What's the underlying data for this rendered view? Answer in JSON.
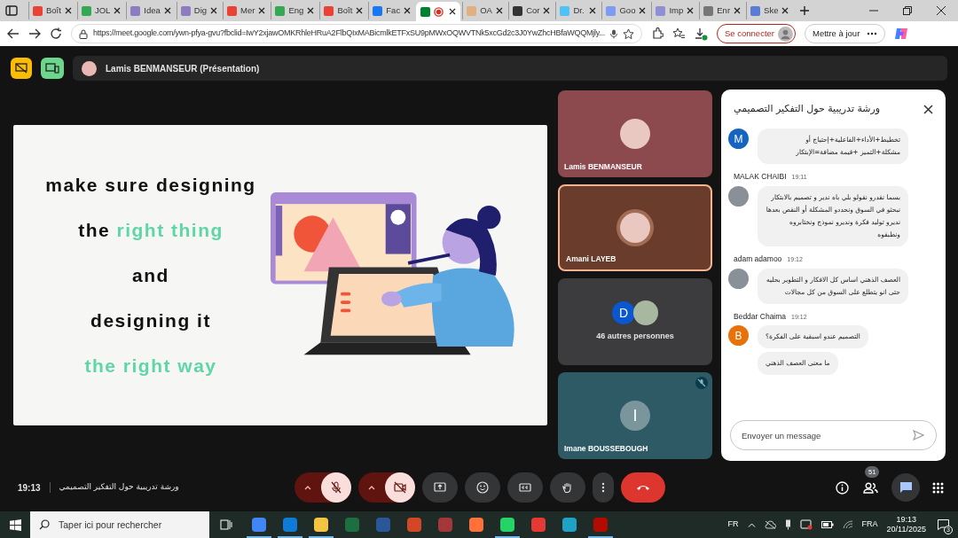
{
  "browser": {
    "tabs": [
      {
        "label": "Boît",
        "selected": false,
        "color": "#ea4335"
      },
      {
        "label": "JOL",
        "selected": false,
        "color": "#34a853"
      },
      {
        "label": "Idea",
        "selected": false,
        "color": "#8e7cc3"
      },
      {
        "label": "Dig",
        "selected": false,
        "color": "#8e7cc3"
      },
      {
        "label": "Mer",
        "selected": false,
        "color": "#ea4335"
      },
      {
        "label": "Eng",
        "selected": false,
        "color": "#34a853"
      },
      {
        "label": "Boît",
        "selected": false,
        "color": "#ea4335"
      },
      {
        "label": "Fac",
        "selected": false,
        "color": "#1877f2"
      },
      {
        "selected": true,
        "color": "#00832d"
      },
      {
        "label": "OA",
        "selected": false,
        "color": "#e0b080"
      },
      {
        "label": "Cor",
        "selected": false,
        "color": "#333333"
      },
      {
        "label": "Dr.",
        "selected": false,
        "color": "#4fc3f7"
      },
      {
        "label": "Goo",
        "selected": false,
        "color": "#7b9cf0"
      },
      {
        "label": "Imp",
        "selected": false,
        "color": "#8f8fd6"
      },
      {
        "label": "Enr",
        "selected": false,
        "color": "#777777"
      },
      {
        "label": "Ske",
        "selected": false,
        "color": "#5a7bd6"
      }
    ],
    "url": "https://meet.google.com/ywn-pfya-gvu?fbclid=IwY2xjawOMKRhleHRuA2FlbQIxMABicmlkETFxSU9pMWxOQWVTNk5xcGd2c3J0YwZhcHBfaWQQMjly...",
    "sign_in": "Se connecter",
    "update": "Mettre à jour"
  },
  "meet": {
    "presenter": "Lamis BENMANSEUR (Présentation)",
    "slide": {
      "lines": [
        [
          {
            "text": "make sure designing",
            "accent": false
          }
        ],
        [
          {
            "text": "the ",
            "accent": false
          },
          {
            "text": "right thing",
            "accent": true
          }
        ],
        [
          {
            "text": "and",
            "accent": false
          }
        ],
        [
          {
            "text": "designing it",
            "accent": false
          }
        ],
        [
          {
            "text": "the right way",
            "accent": true
          }
        ]
      ]
    },
    "tiles": [
      {
        "kind": "photo",
        "name": "Lamis BENMANSEUR",
        "speaking": false,
        "muted": false
      },
      {
        "kind": "photo",
        "name": "Amani LAYEB",
        "speaking": true,
        "muted": false
      },
      {
        "kind": "group",
        "initial": "D",
        "label": "46 autres personnes"
      },
      {
        "kind": "initial",
        "initial": "I",
        "name": "Imane BOUSSEBOUGH",
        "speaking": false,
        "muted": true
      }
    ],
    "chat": {
      "title": "ورشة تدريبية حول التفكير التصميمي",
      "messages": [
        {
          "kind": "initial",
          "initial": "M",
          "color": "#1565c0",
          "texts": [
            "تخطيط+الأداء+الفاعلية+إحتياج أو مشكلة+التميز +قيمة مضافة=الإبتكار"
          ]
        },
        {
          "kind": "photo",
          "sender": "MALAK CHAIBI",
          "time": "19:11",
          "texts": [
            "بسما نقدرو نقولو بلي باه ندير و تصميم بالابتكار نبحثو في السوق ونحددو المشكلة أو النقص بعدها نديرو توليد فكرة ونديرو نموذج ونختابروه ونطبقوه"
          ]
        },
        {
          "kind": "photo",
          "sender": "adam adamoo",
          "time": "19:12",
          "texts": [
            "العصف الذهني اساس كل الافكار و التطوير بحليه حتى انو يتطلع على السوق من كل مجالات"
          ]
        },
        {
          "kind": "initial",
          "initial": "B",
          "color": "#e8710a",
          "sender": "Beddar Chaima",
          "time": "19:12",
          "texts": [
            "التصميم عندو اسبقية على الفكرة؟",
            "ما معنى العصف الذهني"
          ]
        }
      ],
      "placeholder": "Envoyer un message"
    },
    "bottom": {
      "time": "19:13",
      "title": "ورشة تدريبية حول التفكير التصميمي",
      "mic_on": false,
      "camera_on": false,
      "participants": "51",
      "chat_open": true
    }
  },
  "taskbar": {
    "search": {
      "placeholder": "Taper ici pour rechercher"
    },
    "apps": [
      {
        "color": "#4285f4",
        "running": true
      },
      {
        "color": "#0f7bd8",
        "running": true
      },
      {
        "color": "#f4c542",
        "running": true
      },
      {
        "color": "#1d6f42",
        "running": false
      },
      {
        "color": "#2b579a",
        "running": false
      },
      {
        "color": "#d24726",
        "running": false
      },
      {
        "color": "#a4373a",
        "running": false
      },
      {
        "color": "#ff7139",
        "running": false
      },
      {
        "color": "#25d366",
        "running": true
      },
      {
        "color": "#e53935",
        "running": false
      },
      {
        "color": "#1fa2c4",
        "running": false
      },
      {
        "color": "#b30b00",
        "running": true
      }
    ],
    "lang": "FR",
    "keyboard": "FRA",
    "time": "19:13",
    "date": "20/11/2025",
    "notifications": "3"
  }
}
